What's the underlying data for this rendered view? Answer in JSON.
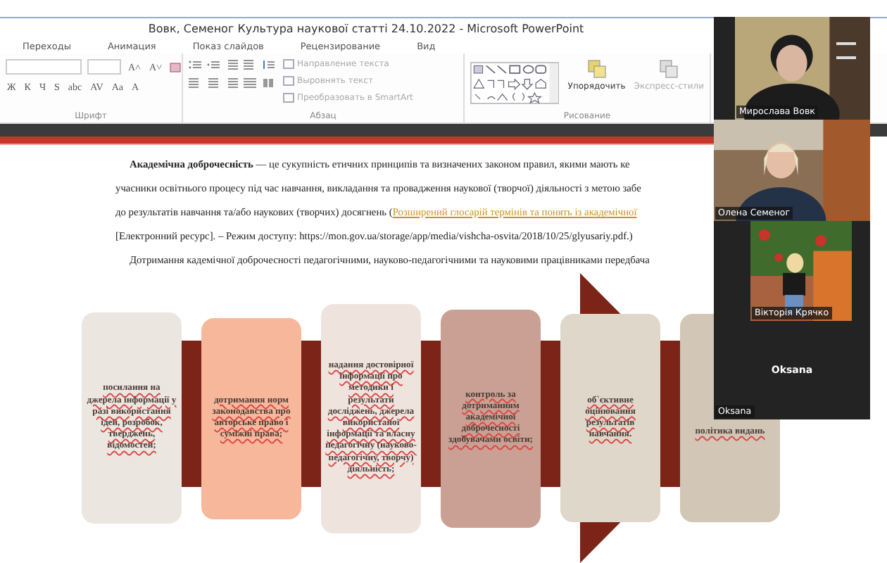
{
  "window": {
    "title": "Вовк, Семеног Культура наукової статті 24.10.2022 - Microsoft PowerPoint"
  },
  "tabs": [
    {
      "label": "Переходы",
      "selected": false
    },
    {
      "label": "Анимация",
      "selected": false
    },
    {
      "label": "Показ слайдов",
      "selected": false
    },
    {
      "label": "Рецензирование",
      "selected": false
    },
    {
      "label": "Вид",
      "selected": false
    }
  ],
  "font_group": {
    "label": "Шрифт",
    "row1": [
      "A˄",
      "A˅"
    ],
    "row2": [
      "Ж",
      "К",
      "Ч",
      "S",
      "abc",
      "AV",
      "Aa",
      "A"
    ]
  },
  "paragraph_group": {
    "label": "Абзац",
    "commands": [
      {
        "label": "Направление текста",
        "disabled": true
      },
      {
        "label": "Выровнять текст",
        "disabled": true
      },
      {
        "label": "Преобразовать в SmartArt",
        "disabled": true
      }
    ]
  },
  "drawing_group": {
    "label": "Рисование",
    "commands": [
      {
        "label": "Упорядочить",
        "disabled": false
      },
      {
        "label": "Экспресс-стили",
        "disabled": true
      }
    ]
  },
  "slide": {
    "paragraphs": [
      {
        "text": "**Академічна доброчесність** — це сукупність етичних принципів та визначених законом правил, якими мають ке",
        "indent": true
      },
      {
        "text": "учасники освітнього процесу під час навчання, викладання та провадження наукової (творчої) діяльності з метою забе",
        "indent": false
      },
      {
        "text": "до результатів навчання та/або наукових (творчих) досягнень (",
        "link": "Розширений глосарій термінів та понять із академічної",
        "indent": false
      },
      {
        "text": "[Електронний ресурс]. – Режим доступу: https://mon.gov.ua/storage/app/media/vishcha-osvita/2018/10/25/glyusariy.pdf.)",
        "indent": false
      },
      {
        "text": "Дотримання кадемічної доброчесності педагогічними, науково-педагогічними та науковими працівниками передбача",
        "indent": true
      }
    ],
    "boxes": [
      {
        "text": "посилання на джерела інформації у разі використання ідей, розробок, тверджень, відомостей;",
        "color": "#ebe6df"
      },
      {
        "text": "дотримання норм законодавства про авторське право і суміжні права;",
        "color": "#f7b79b"
      },
      {
        "text": "надання достовірної інформації про методики і результати досліджень, джерела використаної інформації та власну педагогічну (науково-педагогічну, творчу) діяльність;",
        "color": "#efe3de"
      },
      {
        "text": "контроль за дотриманням академічної доброчесності здобувачами освіти;",
        "color": "#c9a093"
      },
      {
        "text": "об`єктивне оцінювання результатів навчання.",
        "color": "#e0d7cb"
      },
      {
        "text": "політика видань",
        "color": "#d2c6b6"
      }
    ]
  },
  "participants": [
    {
      "name": "Мирослава Вовк",
      "kind": "video"
    },
    {
      "name": "Олена Семеног",
      "kind": "video"
    },
    {
      "name": "Вікторія Крячко",
      "kind": "video"
    },
    {
      "name": "Oksana",
      "display": "Oksana",
      "kind": "no_video"
    }
  ]
}
